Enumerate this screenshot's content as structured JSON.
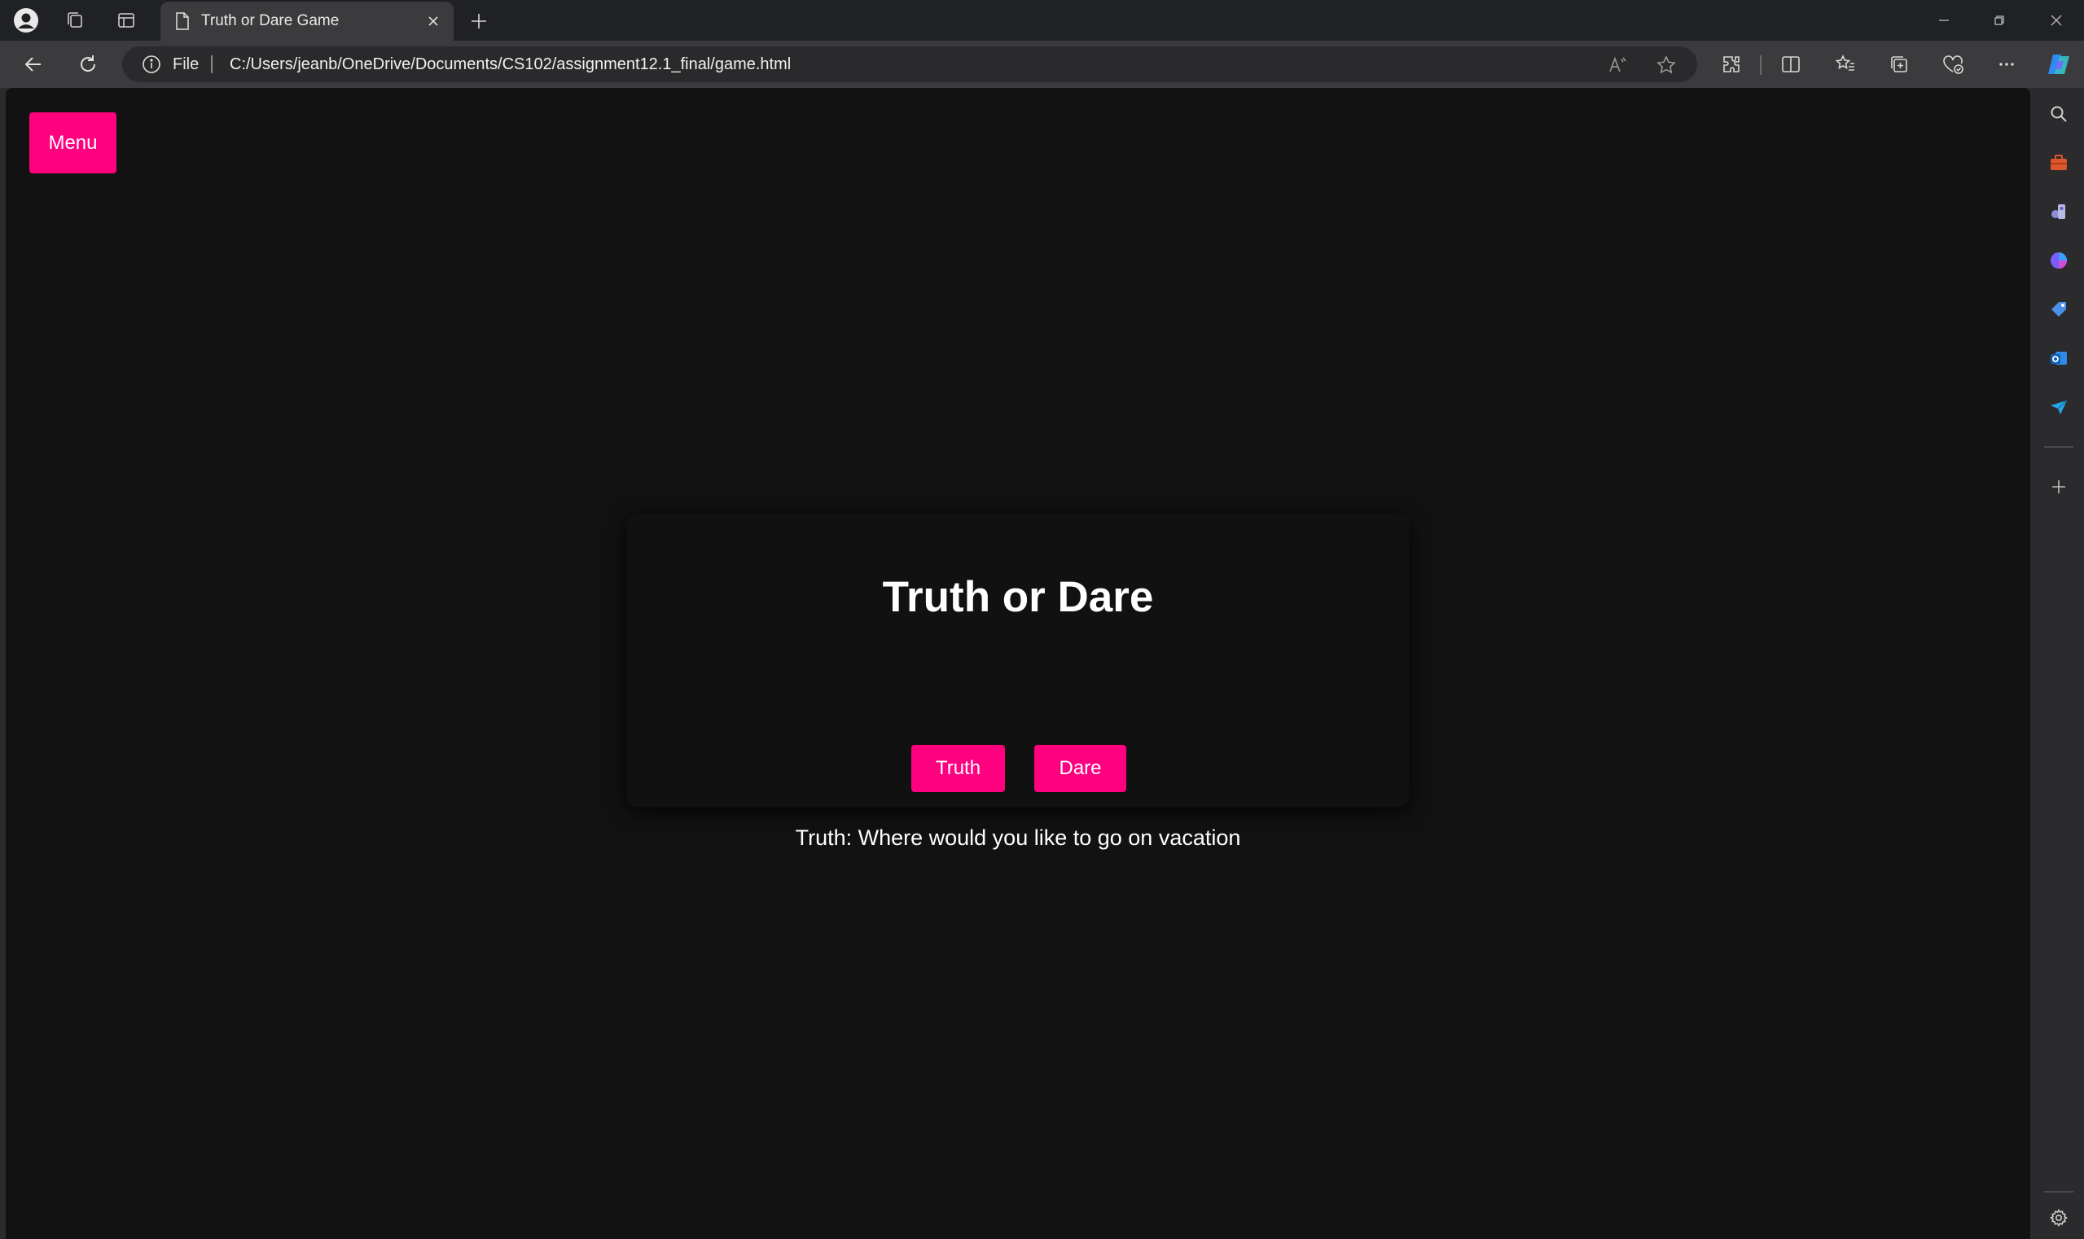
{
  "browser": {
    "tab_title": "Truth or Dare Game",
    "address_scheme": "File",
    "url": "C:/Users/jeanb/OneDrive/Documents/CS102/assignment12.1_final/game.html"
  },
  "page": {
    "menu_label": "Menu",
    "heading": "Truth or Dare",
    "truth_label": "Truth",
    "dare_label": "Dare",
    "result_text": "Truth: Where would you like to go on vacation"
  },
  "colors": {
    "accent": "#ff007f",
    "page_background": "#121212",
    "card_background": "#111111"
  },
  "icons": {
    "titlebar": [
      "profile-icon",
      "workspaces-icon",
      "tab-actions-icon",
      "page-icon",
      "close-icon",
      "new-tab-icon",
      "minimize-icon",
      "restore-icon",
      "window-close-icon"
    ],
    "toolbar": [
      "back-icon",
      "refresh-icon",
      "info-icon",
      "read-aloud-icon",
      "favorite-star-icon",
      "extensions-icon",
      "split-screen-icon",
      "favorites-icon",
      "collections-icon",
      "browser-essentials-icon",
      "more-icon",
      "copilot-icon"
    ],
    "sidebar": [
      "search-icon",
      "tools-icon",
      "games-icon",
      "copilot-sidebar-icon",
      "shopping-icon",
      "outlook-icon",
      "drop-icon",
      "add-icon",
      "settings-icon"
    ]
  }
}
